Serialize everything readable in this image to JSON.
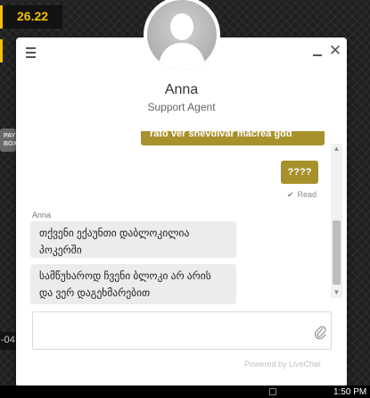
{
  "background": {
    "balance": "26.22",
    "paybox_line1": "PAY",
    "paybox_line2": "BOX",
    "date_fragment": "-04"
  },
  "chat": {
    "agent_name": "Anna",
    "agent_role": "Support Agent",
    "messages": [
      {
        "from": "visitor",
        "text": "rato ver shevdivar macrea gdd",
        "partially_visible": true
      },
      {
        "from": "visitor",
        "text": "????"
      },
      {
        "status": "Read"
      },
      {
        "from": "agent",
        "sender": "Anna",
        "text": "თქვენი ექაუნთი დაბლოკილია პოკერში"
      },
      {
        "from": "agent",
        "text": "სამწუხაროდ ჩვენი ბლოკი არ არის და ვერ დაგეხმარებით"
      }
    ],
    "input_placeholder": "",
    "powered_by": "Powered by LiveChat"
  },
  "icons": {
    "menu": "hamburger-icon",
    "minimize": "minimize-icon",
    "close": "close-icon",
    "attach": "paperclip-icon",
    "read_check": "checkmark-icon"
  },
  "taskbar": {
    "clock": "1:50 PM"
  },
  "colors": {
    "brand_yellow": "#f2c200",
    "visitor_bubble": "#a7912a",
    "agent_bubble": "#ececec"
  }
}
